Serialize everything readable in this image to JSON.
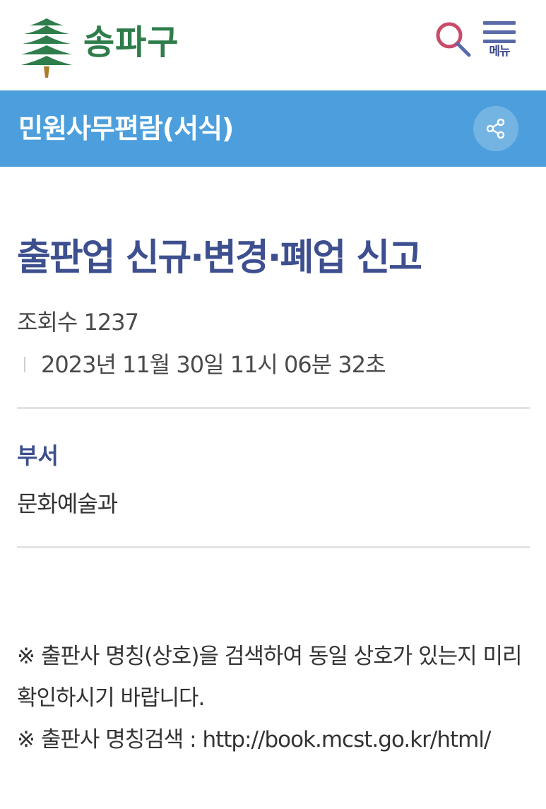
{
  "header": {
    "logo_text": "송파구",
    "menu_label": "메뉴",
    "accent_color": "#2e7d4a",
    "icons": [
      "tree-logo-icon",
      "search-icon",
      "hamburger-menu-icon"
    ]
  },
  "title_bar": {
    "title": "민원사무편람(서식)",
    "background_color": "#4c9fdc",
    "icons": [
      "share-icon"
    ]
  },
  "post": {
    "title": "출판업 신규·변경·폐업 신고",
    "views": "조회수 1237",
    "date": "2023년 11월 30일 11시 06분 32초",
    "dept_label": "부서",
    "dept_value": "문화예술과",
    "notice_line1": "※ 출판사 명칭(상호)을 검색하여 동일 상호가 있는지 미리 확인하시기 바랍니다.",
    "notice_line2": "※ 출판사 명칭검색 : http://book.mcst.go.kr/html/",
    "title_color": "#3d4f8f"
  }
}
